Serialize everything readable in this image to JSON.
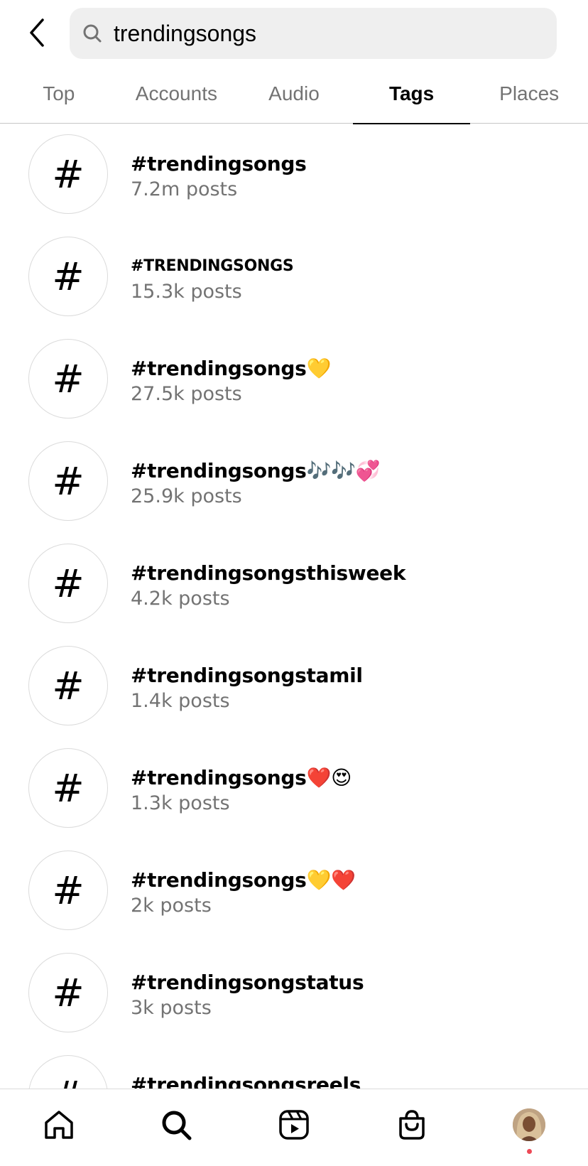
{
  "search": {
    "query": "trendingsongs"
  },
  "tabs": [
    {
      "label": "Top",
      "active": false
    },
    {
      "label": "Accounts",
      "active": false
    },
    {
      "label": "Audio",
      "active": false
    },
    {
      "label": "Tags",
      "active": true
    },
    {
      "label": "Places",
      "active": false
    }
  ],
  "hash_symbol": "#",
  "tags": [
    {
      "name": "#trendingsongs",
      "count": "7.2m posts"
    },
    {
      "name": "#TRENDINGSONGS",
      "count": "15.3k posts"
    },
    {
      "name": "#trendingsongs💛",
      "count": "27.5k posts"
    },
    {
      "name": "#trendingsongs🎶🎶💞",
      "count": "25.9k posts"
    },
    {
      "name": "#trendingsongsthisweek",
      "count": "4.2k posts"
    },
    {
      "name": "#trendingsongstamil",
      "count": "1.4k posts"
    },
    {
      "name": "#trendingsongs❤️😍",
      "count": "1.3k posts"
    },
    {
      "name": "#trendingsongs💛❤️",
      "count": "2k posts"
    },
    {
      "name": "#trendingsongstatus",
      "count": "3k posts"
    },
    {
      "name": "#trendingsongsreels",
      "count": ""
    }
  ],
  "bottom_nav": {
    "icons": [
      "home-icon",
      "search-icon",
      "reels-icon",
      "shop-icon",
      "profile-avatar"
    ],
    "notification_dot_color": "#ed4956"
  },
  "colors": {
    "secondary_text": "#737373",
    "divider": "#dbdbdb",
    "search_bg": "#efefef"
  }
}
